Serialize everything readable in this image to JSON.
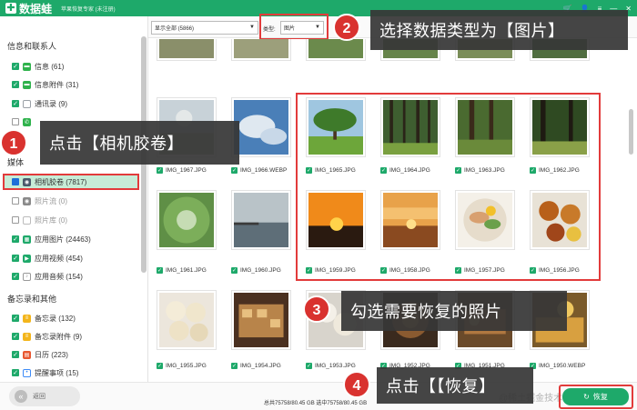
{
  "titlebar": {
    "logo": "数据蛙",
    "subtitle": "苹果恢复专家 (未注册)",
    "controls": [
      "🛒",
      "👤",
      "≡",
      "—",
      "✕"
    ]
  },
  "sidebar": {
    "groups": {
      "info": "信息和联系人",
      "media": "媒体",
      "memo": "备忘录和其他"
    },
    "items": [
      {
        "label": "信息 (61)",
        "checked": true,
        "color": "#2fb24c"
      },
      {
        "label": "信息附件 (31)",
        "checked": true,
        "color": "#2fb24c"
      },
      {
        "label": "通讯录 (9)",
        "checked": true,
        "color": "#9aa0a6"
      },
      {
        "label": "",
        "checked": false,
        "color": "#2fb24c"
      },
      {
        "label": "相机胶卷 (7817)",
        "checked": false,
        "color": "#4a5a6a"
      },
      {
        "label": "照片流 (0)",
        "checked": false,
        "color": "#8a8a8a"
      },
      {
        "label": "照片库 (0)",
        "checked": false,
        "color": "#bbbbbb"
      },
      {
        "label": "应用图片 (24463)",
        "checked": true,
        "color": "#1ea96a"
      },
      {
        "label": "应用视频 (454)",
        "checked": true,
        "color": "#1ea96a"
      },
      {
        "label": "应用音频 (154)",
        "checked": true,
        "color": "#999999"
      },
      {
        "label": "备忘录 (132)",
        "checked": true,
        "color": "#f3b51b"
      },
      {
        "label": "备忘录附件 (9)",
        "checked": true,
        "color": "#f3b51b"
      },
      {
        "label": "日历 (223)",
        "checked": true,
        "color": "#e8562f"
      },
      {
        "label": "提醒事项 (15)",
        "checked": true,
        "color": "#3d8bf7"
      }
    ]
  },
  "toolbar": {
    "filter_value": "显示全部 (5866)",
    "type_label": "类型:",
    "type_value": "图片"
  },
  "photos": [
    "IMG_1967.JPG",
    "IMG_1966.WEBP",
    "IMG_1965.JPG",
    "IMG_1964.JPG",
    "IMG_1963.JPG",
    "IMG_1962.JPG",
    "IMG_1961.JPG",
    "IMG_1960.JPG",
    "IMG_1959.JPG",
    "IMG_1958.JPG",
    "IMG_1957.JPG",
    "IMG_1956.JPG",
    "IMG_1955.JPG",
    "IMG_1954.JPG",
    "IMG_1953.JPG",
    "IMG_1952.JPG",
    "IMG_1951.JPG",
    "IMG_1950.WEBP"
  ],
  "bottom": {
    "back_label": "返回",
    "back_icon": "«",
    "status": "总共75758/80.45 GB 选中75758/80.45 GB",
    "recover_label": "恢复",
    "watermark": "@稀土掘金技术社区"
  },
  "annotations": [
    {
      "num": "1",
      "text": "点击【相机胶卷】"
    },
    {
      "num": "2",
      "text": "选择数据类型为【图片】"
    },
    {
      "num": "3",
      "text": "勾选需要恢复的照片"
    },
    {
      "num": "4",
      "text": "点击【【恢复】"
    }
  ]
}
